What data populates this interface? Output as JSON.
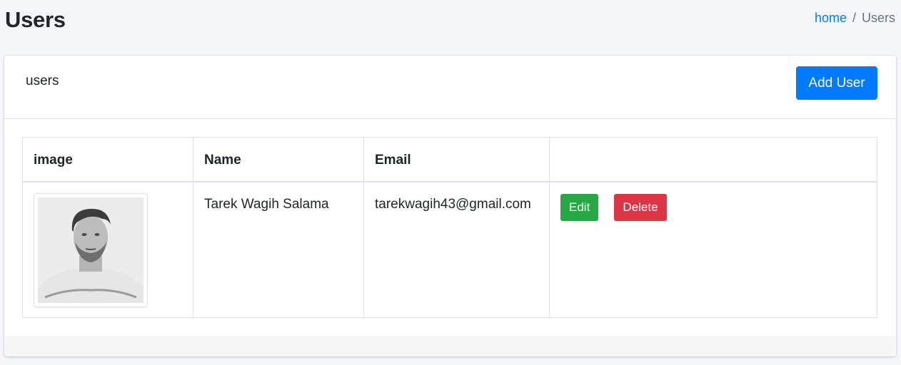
{
  "header": {
    "title": "Users",
    "breadcrumb": {
      "home": "home",
      "separator": "/",
      "current": "Users"
    }
  },
  "card": {
    "title": "users",
    "add_button": "Add User"
  },
  "table": {
    "columns": [
      "image",
      "Name",
      "Email",
      ""
    ],
    "rows": [
      {
        "image": "user-photo",
        "name": "Tarek Wagih Salama",
        "email": "tarekwagih43@gmail.com",
        "actions": {
          "edit": "Edit",
          "delete": "Delete"
        }
      }
    ]
  },
  "colors": {
    "primary": "#007bff",
    "success": "#28a745",
    "danger": "#dc3545",
    "background": "#f4f6f9"
  }
}
